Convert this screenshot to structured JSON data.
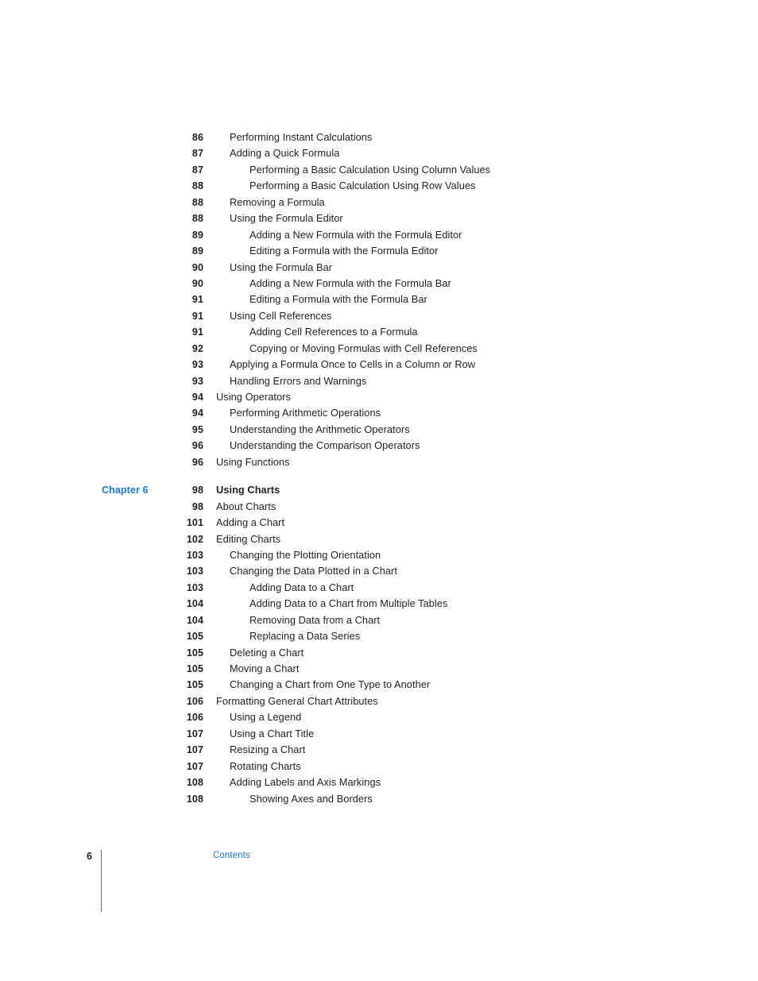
{
  "document": {
    "section_name": "Contents",
    "page_number": "6",
    "accent_color": "#1b77d0",
    "text_color": "#231f20"
  },
  "toc": {
    "entries": [
      {
        "chapter": "",
        "page": "86",
        "title": "Performing Instant Calculations",
        "level": 1,
        "bold": false,
        "gap_before": false
      },
      {
        "chapter": "",
        "page": "87",
        "title": "Adding a Quick Formula",
        "level": 1,
        "bold": false,
        "gap_before": false
      },
      {
        "chapter": "",
        "page": "87",
        "title": "Performing a Basic Calculation Using Column Values",
        "level": 2,
        "bold": false,
        "gap_before": false
      },
      {
        "chapter": "",
        "page": "88",
        "title": "Performing a Basic Calculation Using Row Values",
        "level": 2,
        "bold": false,
        "gap_before": false
      },
      {
        "chapter": "",
        "page": "88",
        "title": "Removing a Formula",
        "level": 1,
        "bold": false,
        "gap_before": false
      },
      {
        "chapter": "",
        "page": "88",
        "title": "Using the Formula Editor",
        "level": 1,
        "bold": false,
        "gap_before": false
      },
      {
        "chapter": "",
        "page": "89",
        "title": "Adding a New Formula with the Formula Editor",
        "level": 2,
        "bold": false,
        "gap_before": false
      },
      {
        "chapter": "",
        "page": "89",
        "title": "Editing a Formula with the Formula Editor",
        "level": 2,
        "bold": false,
        "gap_before": false
      },
      {
        "chapter": "",
        "page": "90",
        "title": "Using the Formula Bar",
        "level": 1,
        "bold": false,
        "gap_before": false
      },
      {
        "chapter": "",
        "page": "90",
        "title": "Adding a New Formula with the Formula Bar",
        "level": 2,
        "bold": false,
        "gap_before": false
      },
      {
        "chapter": "",
        "page": "91",
        "title": "Editing a Formula with the Formula Bar",
        "level": 2,
        "bold": false,
        "gap_before": false
      },
      {
        "chapter": "",
        "page": "91",
        "title": "Using Cell References",
        "level": 1,
        "bold": false,
        "gap_before": false
      },
      {
        "chapter": "",
        "page": "91",
        "title": "Adding Cell References to a Formula",
        "level": 2,
        "bold": false,
        "gap_before": false
      },
      {
        "chapter": "",
        "page": "92",
        "title": "Copying or Moving Formulas with Cell References",
        "level": 2,
        "bold": false,
        "gap_before": false
      },
      {
        "chapter": "",
        "page": "93",
        "title": "Applying a Formula Once to Cells in a Column or Row",
        "level": 1,
        "bold": false,
        "gap_before": false
      },
      {
        "chapter": "",
        "page": "93",
        "title": "Handling Errors and Warnings",
        "level": 1,
        "bold": false,
        "gap_before": false
      },
      {
        "chapter": "",
        "page": "94",
        "title": "Using Operators",
        "level": 0,
        "bold": false,
        "gap_before": false
      },
      {
        "chapter": "",
        "page": "94",
        "title": "Performing Arithmetic Operations",
        "level": 1,
        "bold": false,
        "gap_before": false
      },
      {
        "chapter": "",
        "page": "95",
        "title": "Understanding the Arithmetic Operators",
        "level": 1,
        "bold": false,
        "gap_before": false
      },
      {
        "chapter": "",
        "page": "96",
        "title": "Understanding the Comparison Operators",
        "level": 1,
        "bold": false,
        "gap_before": false
      },
      {
        "chapter": "",
        "page": "96",
        "title": "Using Functions",
        "level": 0,
        "bold": false,
        "gap_before": false
      },
      {
        "chapter": "Chapter 6",
        "page": "98",
        "title": "Using Charts",
        "level": 0,
        "bold": true,
        "gap_before": true
      },
      {
        "chapter": "",
        "page": "98",
        "title": "About Charts",
        "level": 0,
        "bold": false,
        "gap_before": false
      },
      {
        "chapter": "",
        "page": "101",
        "title": "Adding a Chart",
        "level": 0,
        "bold": false,
        "gap_before": false
      },
      {
        "chapter": "",
        "page": "102",
        "title": "Editing Charts",
        "level": 0,
        "bold": false,
        "gap_before": false
      },
      {
        "chapter": "",
        "page": "103",
        "title": "Changing the Plotting Orientation",
        "level": 1,
        "bold": false,
        "gap_before": false
      },
      {
        "chapter": "",
        "page": "103",
        "title": "Changing the Data Plotted in a Chart",
        "level": 1,
        "bold": false,
        "gap_before": false
      },
      {
        "chapter": "",
        "page": "103",
        "title": "Adding Data to a Chart",
        "level": 2,
        "bold": false,
        "gap_before": false
      },
      {
        "chapter": "",
        "page": "104",
        "title": "Adding Data to a Chart from Multiple Tables",
        "level": 2,
        "bold": false,
        "gap_before": false
      },
      {
        "chapter": "",
        "page": "104",
        "title": "Removing Data from a Chart",
        "level": 2,
        "bold": false,
        "gap_before": false
      },
      {
        "chapter": "",
        "page": "105",
        "title": "Replacing a Data Series",
        "level": 2,
        "bold": false,
        "gap_before": false
      },
      {
        "chapter": "",
        "page": "105",
        "title": "Deleting a Chart",
        "level": 1,
        "bold": false,
        "gap_before": false
      },
      {
        "chapter": "",
        "page": "105",
        "title": "Moving a Chart",
        "level": 1,
        "bold": false,
        "gap_before": false
      },
      {
        "chapter": "",
        "page": "105",
        "title": "Changing a Chart from One Type to Another",
        "level": 1,
        "bold": false,
        "gap_before": false
      },
      {
        "chapter": "",
        "page": "106",
        "title": "Formatting General Chart Attributes",
        "level": 0,
        "bold": false,
        "gap_before": false
      },
      {
        "chapter": "",
        "page": "106",
        "title": "Using a Legend",
        "level": 1,
        "bold": false,
        "gap_before": false
      },
      {
        "chapter": "",
        "page": "107",
        "title": "Using a Chart Title",
        "level": 1,
        "bold": false,
        "gap_before": false
      },
      {
        "chapter": "",
        "page": "107",
        "title": "Resizing a Chart",
        "level": 1,
        "bold": false,
        "gap_before": false
      },
      {
        "chapter": "",
        "page": "107",
        "title": "Rotating Charts",
        "level": 1,
        "bold": false,
        "gap_before": false
      },
      {
        "chapter": "",
        "page": "108",
        "title": "Adding Labels and Axis Markings",
        "level": 1,
        "bold": false,
        "gap_before": false
      },
      {
        "chapter": "",
        "page": "108",
        "title": "Showing Axes and Borders",
        "level": 2,
        "bold": false,
        "gap_before": false
      }
    ]
  }
}
